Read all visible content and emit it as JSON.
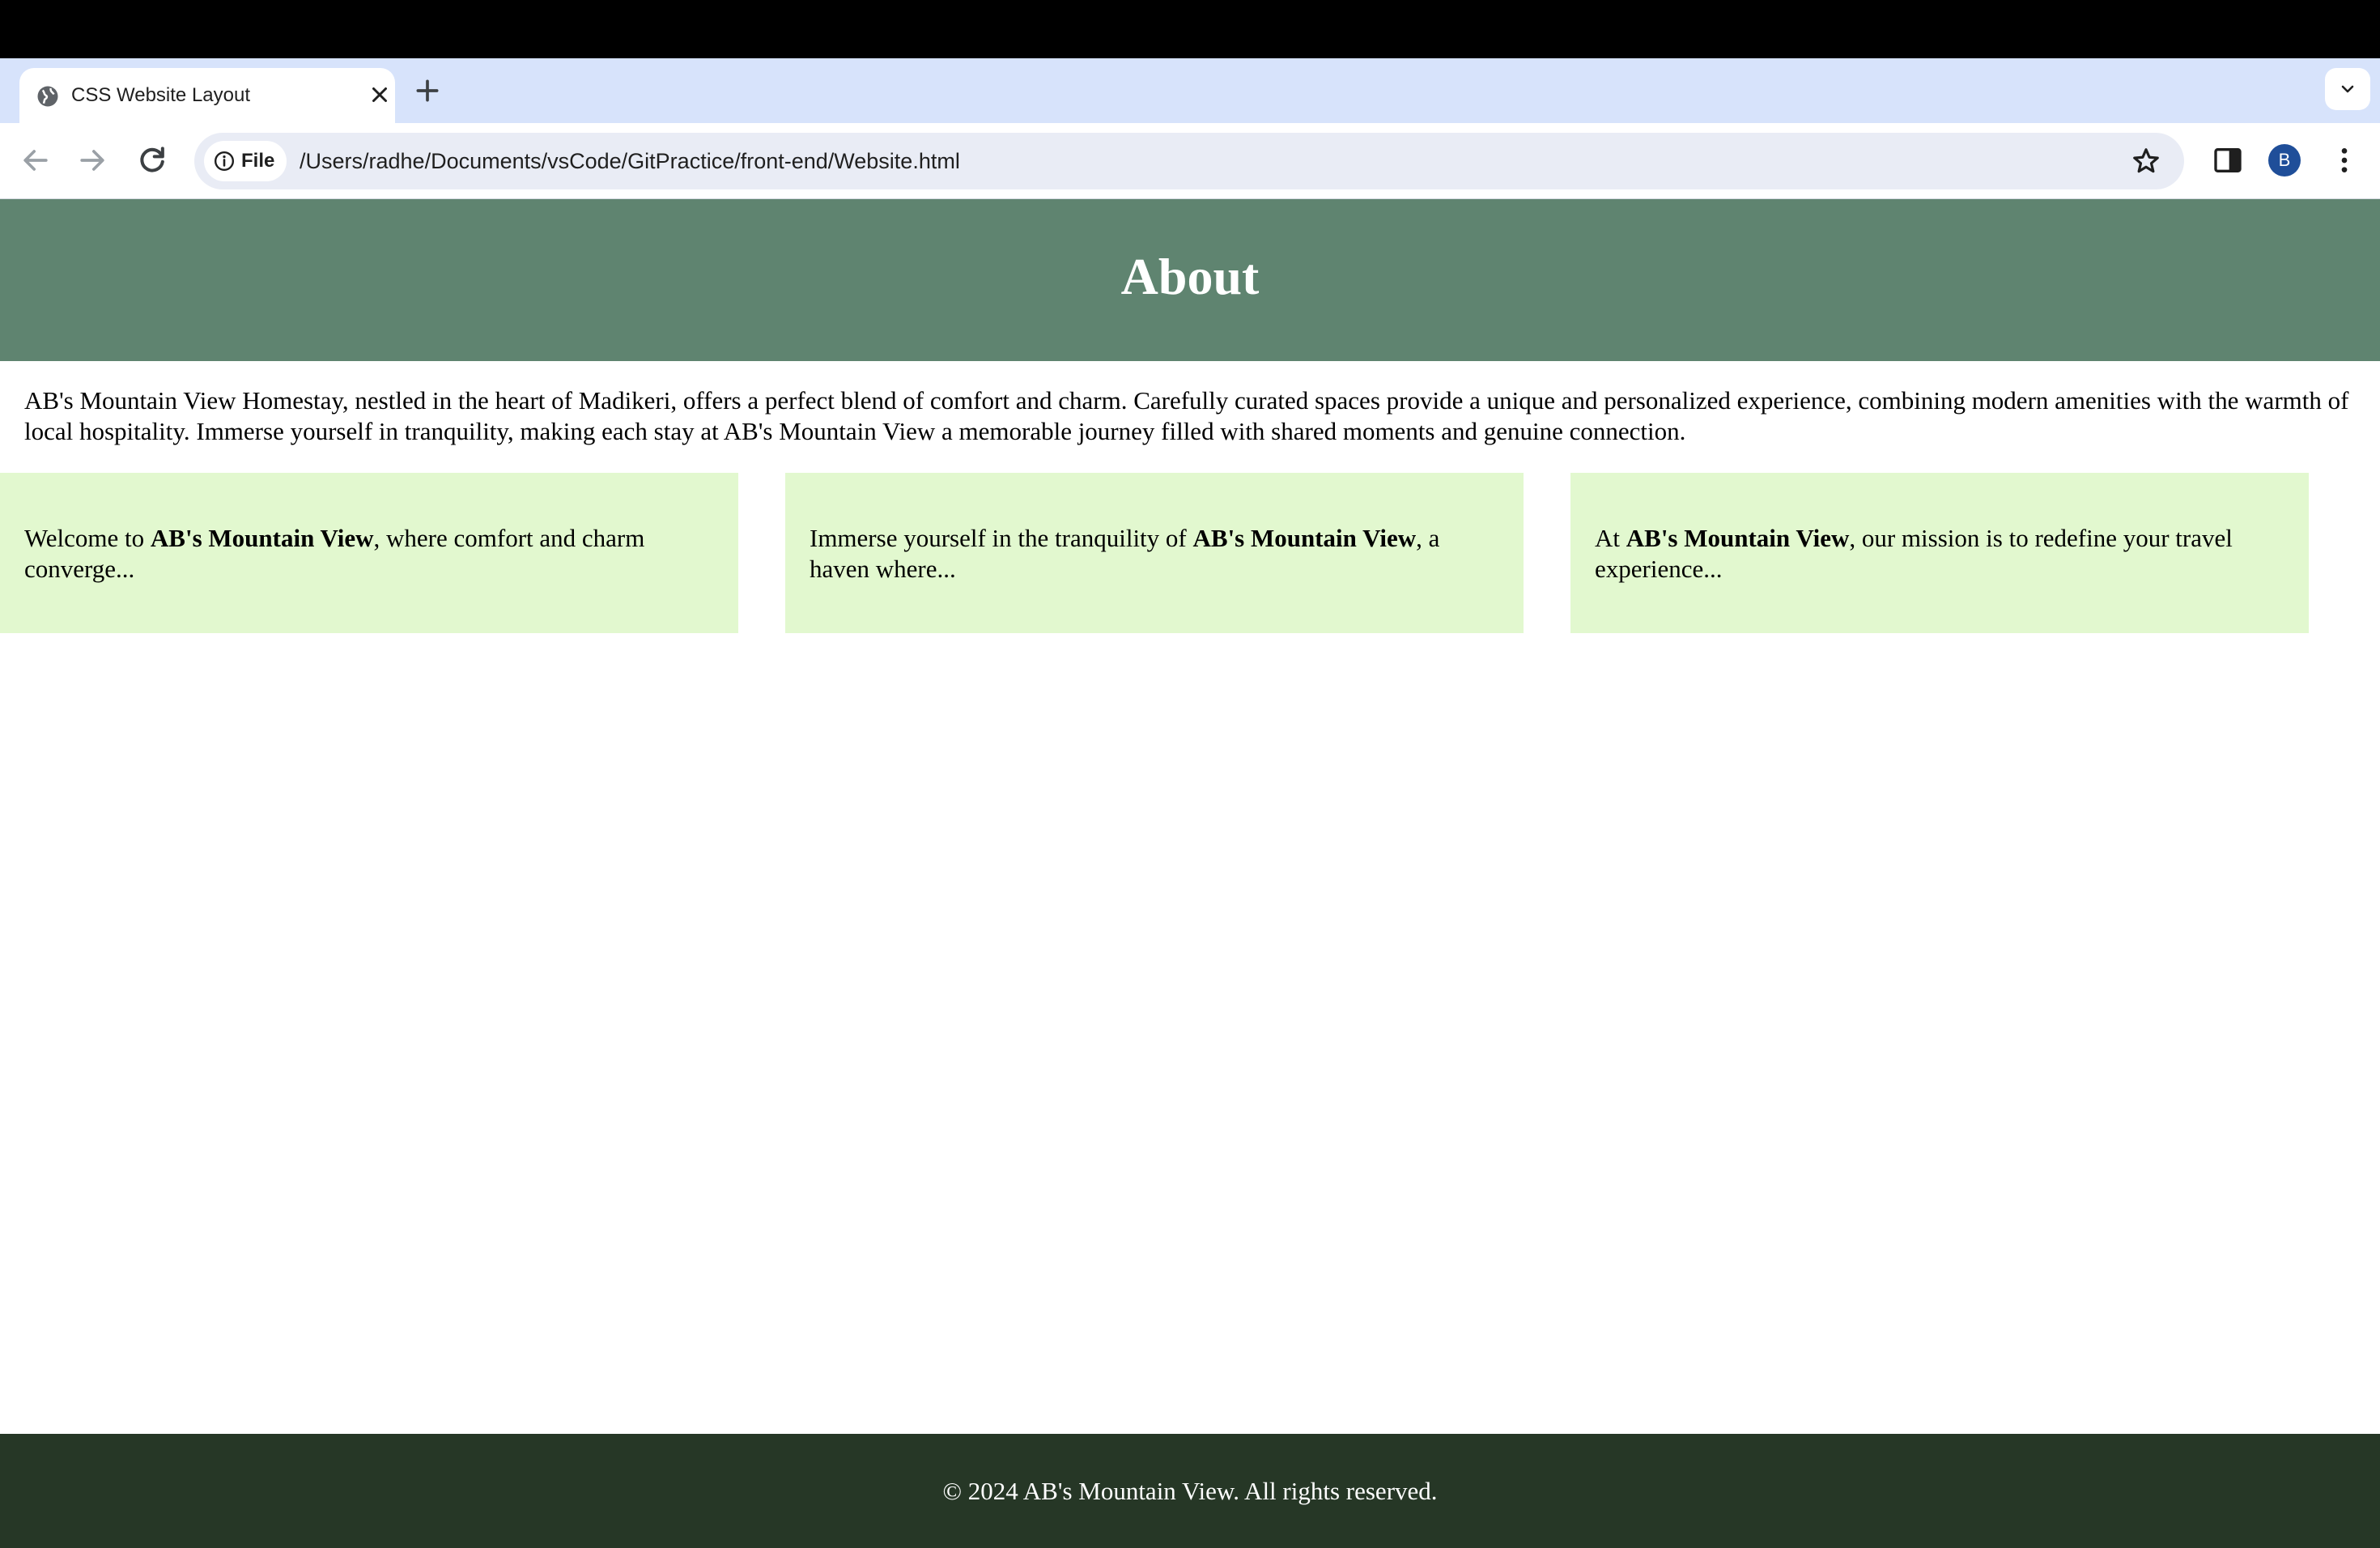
{
  "browser": {
    "tab_title": "CSS Website Layout",
    "chip_label": "File",
    "url": "/Users/radhe/Documents/vsCode/GitPractice/front-end/Website.html",
    "avatar_letter": "B"
  },
  "page": {
    "header_title": "About",
    "about_text": "AB's Mountain View Homestay, nestled in the heart of Madikeri, offers a perfect blend of comfort and charm. Carefully curated spaces provide a unique and personalized experience, combining modern amenities with the warmth of local hospitality. Immerse yourself in tranquility, making each stay at AB's Mountain View a memorable journey filled with shared moments and genuine connection.",
    "cards": [
      {
        "before": "Welcome to ",
        "bold": "AB's Mountain View",
        "after": ", where comfort and charm converge..."
      },
      {
        "before": "Immerse yourself in the tranquility of ",
        "bold": "AB's Mountain View",
        "after": ", a haven where..."
      },
      {
        "before": "At ",
        "bold": "AB's Mountain View",
        "after": ", our mission is to redefine your travel experience..."
      }
    ],
    "footer_text": "© 2024 AB's Mountain View. All rights reserved."
  },
  "colors": {
    "header_bg": "#5f8470",
    "card_bg": "#e2f8cf",
    "footer_bg": "#263726",
    "tabstrip_bg": "#d7e3fb"
  }
}
